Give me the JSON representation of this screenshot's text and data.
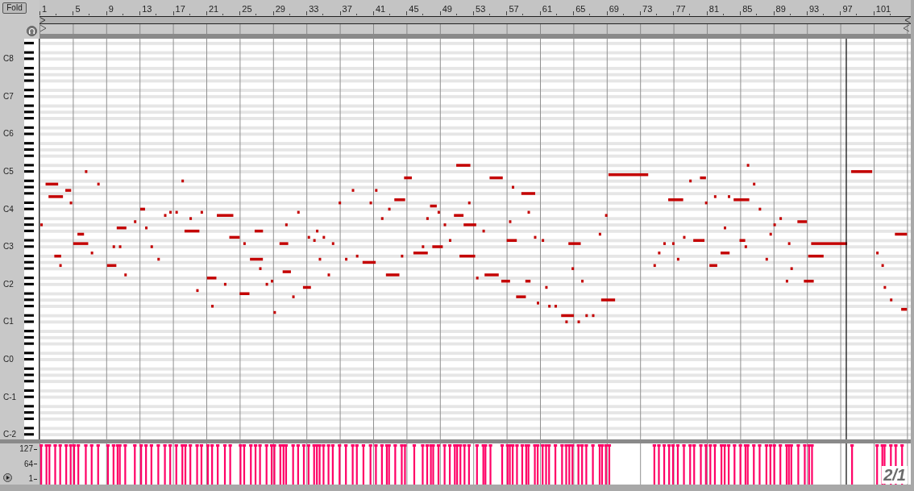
{
  "toolbar": {
    "fold_button": "Fold"
  },
  "ruler": {
    "bar_numbers": [
      "1",
      "5",
      "9",
      "13",
      "17",
      "21",
      "25",
      "29",
      "33",
      "37",
      "41",
      "45",
      "49",
      "53",
      "57",
      "61",
      "65",
      "69",
      "73",
      "77",
      "81",
      "85",
      "89",
      "93",
      "97",
      "101"
    ]
  },
  "piano_keys": {
    "octave_labels": [
      "C8",
      "C7",
      "C6",
      "C5",
      "C4",
      "C3",
      "C2",
      "C1",
      "C0",
      "C-1",
      "C-2"
    ]
  },
  "velocity_lane": {
    "axis_labels": [
      "127",
      "64",
      "1"
    ]
  },
  "grid_label": "2/1"
}
